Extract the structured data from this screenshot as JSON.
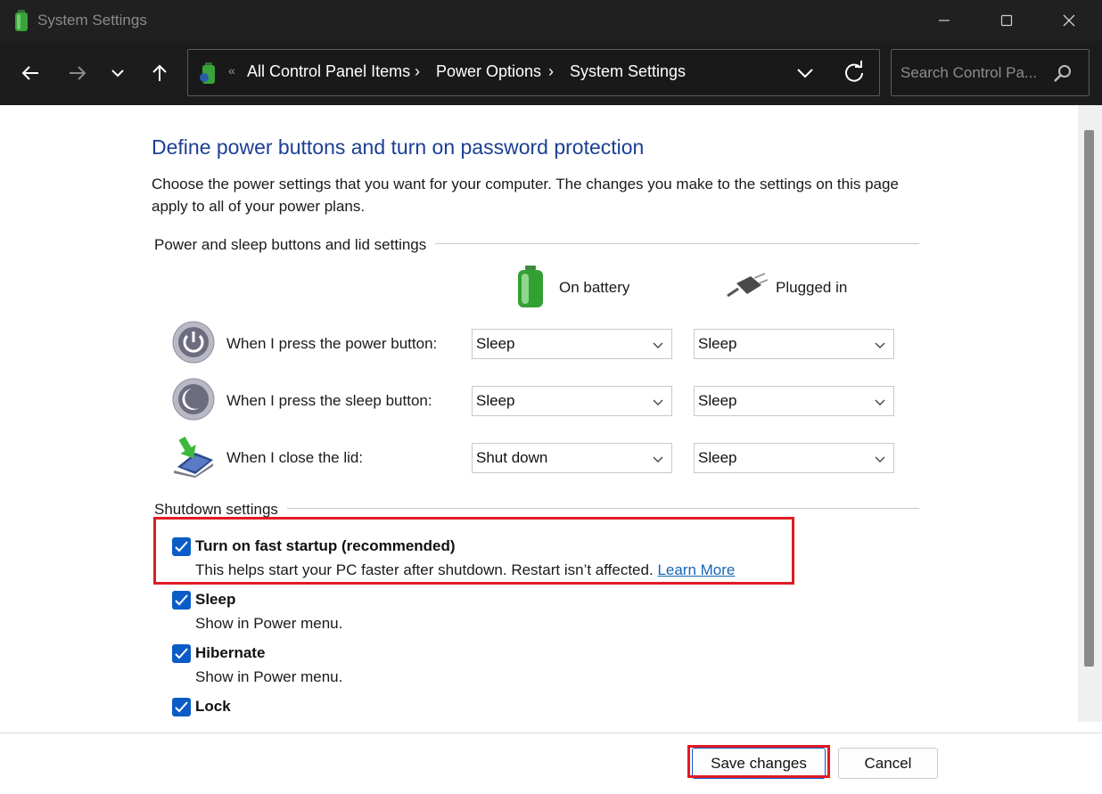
{
  "window": {
    "title": "System Settings",
    "controls": {
      "minimize": "—",
      "maximize": "☐",
      "close": "✕"
    }
  },
  "nav": {
    "back_icon": "arrow-left-icon",
    "forward_icon": "arrow-right-icon",
    "recent_icon": "chevron-down-icon",
    "up_icon": "arrow-up-icon"
  },
  "address": {
    "prefix": "«",
    "crumbs": [
      "All Control Panel Items",
      "Power Options",
      "System Settings"
    ],
    "separator": "›"
  },
  "search": {
    "placeholder": "Search Control Pa..."
  },
  "page": {
    "heading": "Define power buttons and turn on password protection",
    "description": "Choose the power settings that you want for your computer. The changes you make to the settings on this page apply to all of your power plans.",
    "power_group_title": "Power and sleep buttons and lid settings",
    "columns": {
      "battery": "On battery",
      "plugged": "Plugged in"
    },
    "rows": [
      {
        "label": "When I press the power button:",
        "battery": "Sleep",
        "plugged": "Sleep",
        "icon": "power-button-icon"
      },
      {
        "label": "When I press the sleep button:",
        "battery": "Sleep",
        "plugged": "Sleep",
        "icon": "sleep-button-icon"
      },
      {
        "label": "When I close the lid:",
        "battery": "Shut down",
        "plugged": "Sleep",
        "icon": "laptop-lid-icon"
      }
    ],
    "shutdown_group_title": "Shutdown settings",
    "shutdown": [
      {
        "label": "Turn on fast startup (recommended)",
        "desc": "This helps start your PC faster after shutdown. Restart isn’t affected.",
        "link": "Learn More",
        "checked": true
      },
      {
        "label": "Sleep",
        "desc": "Show in Power menu.",
        "checked": true
      },
      {
        "label": "Hibernate",
        "desc": "Show in Power menu.",
        "checked": true
      },
      {
        "label": "Lock",
        "checked": true
      }
    ]
  },
  "footer": {
    "save": "Save changes",
    "cancel": "Cancel"
  },
  "colors": {
    "heading": "#1c3f94",
    "checkbox": "#0b5cc6",
    "highlight": "#e01b25",
    "link": "#1964b7"
  }
}
